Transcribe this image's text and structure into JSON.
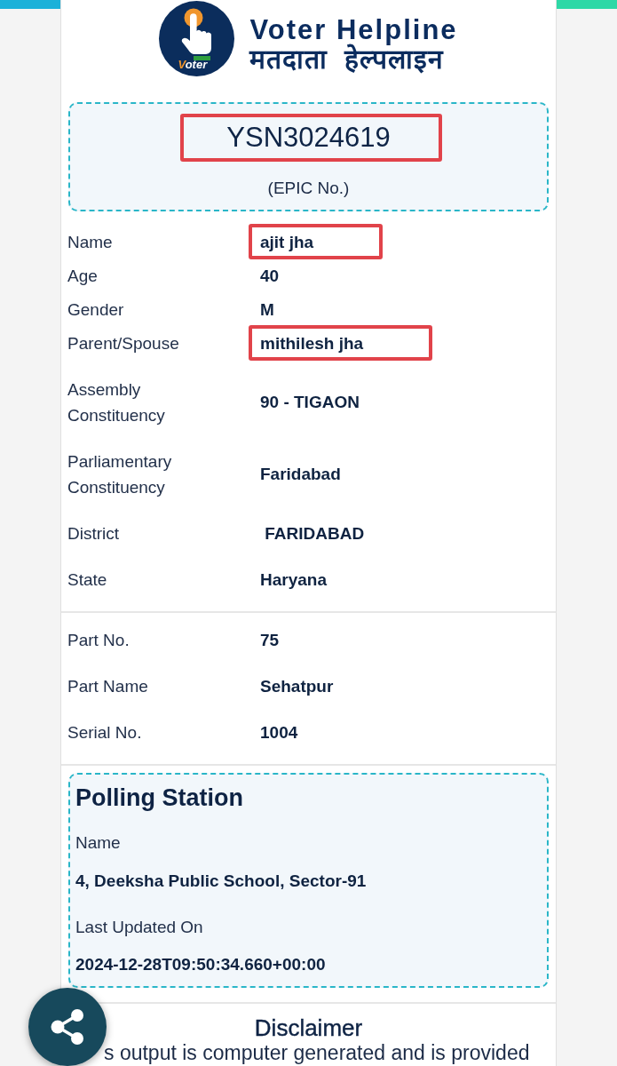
{
  "header": {
    "emblem_text": "Voter",
    "title": "Voter Helpline",
    "subtitle": "मतदाता  हेल्पलाइन"
  },
  "epic": {
    "number": "YSN3024619",
    "caption": "(EPIC No.)",
    "highlighted": true
  },
  "details": {
    "identity_rows": [
      {
        "label": "Name",
        "value": "ajit jha",
        "highlighted": true
      },
      {
        "label": "Age",
        "value": "40",
        "highlighted": false
      },
      {
        "label": "Gender",
        "value": "M",
        "highlighted": false
      },
      {
        "label": "Parent/Spouse",
        "value": "mithilesh jha",
        "highlighted": true
      }
    ],
    "constituency_rows": [
      {
        "label": "Assembly Constituency",
        "value": "90 - TIGAON",
        "highlighted": false
      },
      {
        "label": "Parliamentary Constituency",
        "value": "Faridabad",
        "highlighted": false
      },
      {
        "label": "District",
        "value": " FARIDABAD",
        "highlighted": false
      },
      {
        "label": "State",
        "value": "Haryana",
        "highlighted": false
      }
    ]
  },
  "part": {
    "rows": [
      {
        "label": "Part No.",
        "value": "75",
        "highlighted": false
      },
      {
        "label": "Part Name",
        "value": "Sehatpur",
        "highlighted": false
      },
      {
        "label": "Serial No.",
        "value": "1004",
        "highlighted": false
      }
    ]
  },
  "polling_station": {
    "title": "Polling Station",
    "fields": [
      {
        "label": "Name",
        "value": "4, Deeksha Public School, Sector-91"
      },
      {
        "label": "Last Updated On",
        "value": "2024-12-28T09:50:34.660+00:00"
      }
    ]
  },
  "disclaimer": {
    "title": "Disclaimer",
    "text": "s output is computer generated and is provided"
  }
}
